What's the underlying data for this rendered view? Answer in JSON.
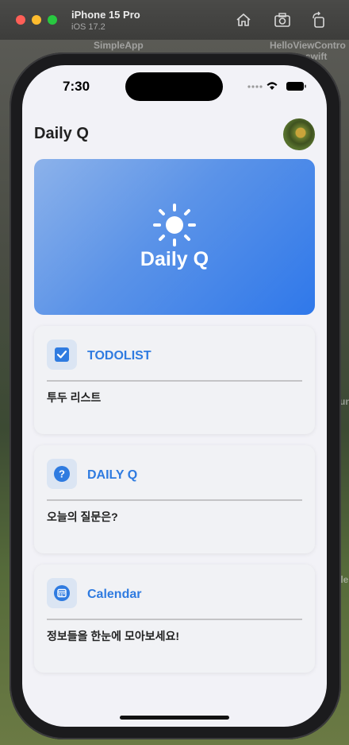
{
  "window": {
    "device_name": "iPhone 15 Pro",
    "os_version": "iOS 17.2",
    "background_labels": [
      "SimpleApp",
      "HelloViewContro",
      "swift",
      "un",
      "lle"
    ]
  },
  "status_bar": {
    "time": "7:30"
  },
  "nav": {
    "title": "Daily Q"
  },
  "hero": {
    "title": "Daily Q"
  },
  "cards": [
    {
      "title": "TODOLIST",
      "subtitle": "투두 리스트",
      "icon": "checkbox-icon"
    },
    {
      "title": "DAILY Q",
      "subtitle": "오늘의 질문은?",
      "icon": "question-circle-icon"
    },
    {
      "title": "Calendar",
      "subtitle": "정보들을 한눈에 모아보세요!",
      "icon": "calendar-icon"
    }
  ],
  "colors": {
    "accent": "#2f7be0",
    "hero_start": "#8cb2ea",
    "hero_end": "#2f78ea",
    "background": "#f2f2f7"
  }
}
